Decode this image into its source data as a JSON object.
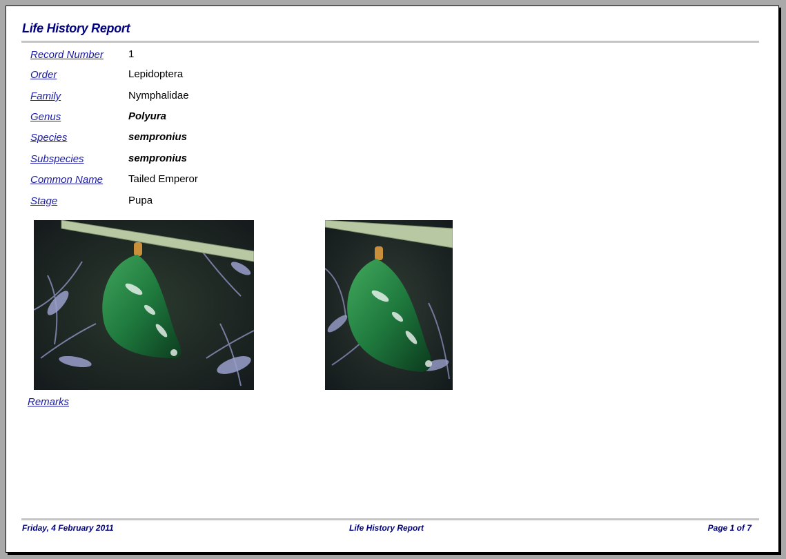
{
  "report": {
    "title": "Life History Report"
  },
  "fields": {
    "record_number": {
      "label": "Record Number",
      "value": "1"
    },
    "order": {
      "label": "Order",
      "value": "Lepidoptera"
    },
    "family": {
      "label": "Family",
      "value": "Nymphalidae"
    },
    "genus": {
      "label": "Genus",
      "value": "Polyura"
    },
    "species": {
      "label": "Species",
      "value": "sempronius"
    },
    "subspecies": {
      "label": "Subspecies",
      "value": "sempronius"
    },
    "common_name": {
      "label": "Common Name",
      "value": "Tailed Emperor"
    },
    "stage": {
      "label": "Stage",
      "value": "Pupa"
    }
  },
  "photos": [
    {
      "subject": "green-pupa-hanging-from-stem"
    },
    {
      "subject": "green-pupa-hanging-from-stem"
    }
  ],
  "remarks": {
    "label": "Remarks",
    "value": ""
  },
  "footer": {
    "date": "Friday, 4 February 2011",
    "title": "Life History Report",
    "page": "Page 1 of 7"
  },
  "colors": {
    "heading": "#000080",
    "label_link": "#1a1aa6",
    "rule": "#c4c4c4",
    "pupa_green": "#1f7a3e"
  }
}
